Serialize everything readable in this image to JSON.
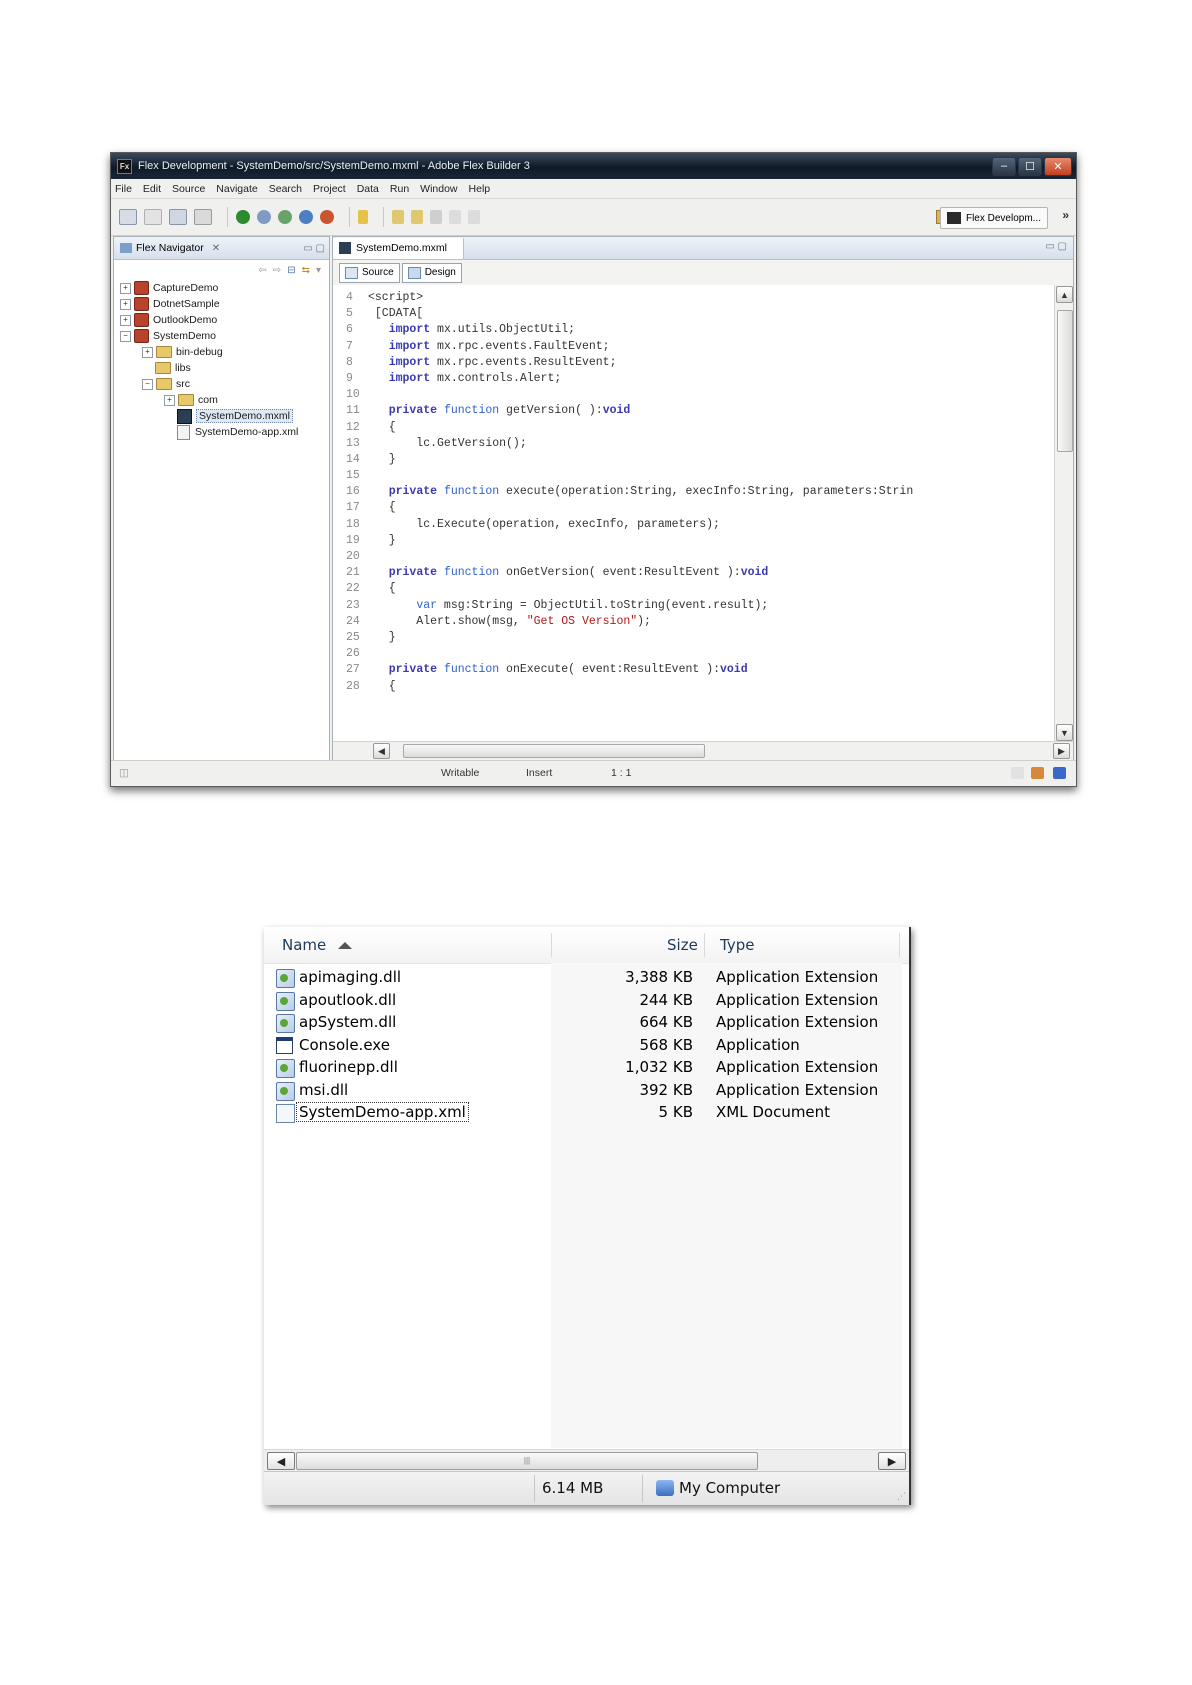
{
  "flex_builder": {
    "title": "Flex Development - SystemDemo/src/SystemDemo.mxml - Adobe Flex Builder 3",
    "app_icon": "Fx",
    "menu": [
      "File",
      "Edit",
      "Source",
      "Navigate",
      "Search",
      "Project",
      "Data",
      "Run",
      "Window",
      "Help"
    ],
    "perspective": "Flex Developm...",
    "perspective_overflow": "»",
    "navigator": {
      "tab": "Flex Navigator",
      "tab_close": "✕",
      "items": [
        {
          "label": "CaptureDemo",
          "exp": "+"
        },
        {
          "label": "DotnetSample",
          "exp": "+"
        },
        {
          "label": "OutlookDemo",
          "exp": "+"
        },
        {
          "label": "SystemDemo",
          "exp": "−"
        },
        {
          "label": "bin-debug",
          "exp": "+"
        },
        {
          "label": "libs"
        },
        {
          "label": "src",
          "exp": "−"
        },
        {
          "label": "com",
          "exp": "+"
        },
        {
          "label": "SystemDemo.mxml"
        },
        {
          "label": "SystemDemo-app.xml"
        }
      ]
    },
    "editor": {
      "tab": "SystemDemo.mxml",
      "source_btn": "Source",
      "design_btn": "Design",
      "lines": [
        {
          "n": "4",
          "t": "<script>"
        },
        {
          "n": "5",
          "t": " [CDATA["
        },
        {
          "n": "6",
          "t": "   import mx.utils.ObjectUtil;"
        },
        {
          "n": "7",
          "t": "   import mx.rpc.events.FaultEvent;"
        },
        {
          "n": "8",
          "t": "   import mx.rpc.events.ResultEvent;"
        },
        {
          "n": "9",
          "t": "   import mx.controls.Alert;"
        },
        {
          "n": "10",
          "t": ""
        },
        {
          "n": "11",
          "t": "   private function getVersion( ):void"
        },
        {
          "n": "12",
          "t": "   {"
        },
        {
          "n": "13",
          "t": "       lc.GetVersion();"
        },
        {
          "n": "14",
          "t": "   }"
        },
        {
          "n": "15",
          "t": ""
        },
        {
          "n": "16",
          "t": "   private function execute(operation:String, execInfo:String, parameters:Strin"
        },
        {
          "n": "17",
          "t": "   {"
        },
        {
          "n": "18",
          "t": "       lc.Execute(operation, execInfo, parameters);"
        },
        {
          "n": "19",
          "t": "   }"
        },
        {
          "n": "20",
          "t": ""
        },
        {
          "n": "21",
          "t": "   private function onGetVersion( event:ResultEvent ):void"
        },
        {
          "n": "22",
          "t": "   {"
        },
        {
          "n": "23",
          "t": "       var msg:String = ObjectUtil.toString(event.result);"
        },
        {
          "n": "24",
          "t": "       Alert.show(msg, \"Get OS Version\");"
        },
        {
          "n": "25",
          "t": "   }"
        },
        {
          "n": "26",
          "t": ""
        },
        {
          "n": "27",
          "t": "   private function onExecute( event:ResultEvent ):void"
        },
        {
          "n": "28",
          "t": "   {"
        }
      ]
    },
    "status": {
      "writable": "Writable",
      "insert": "Insert",
      "position": "1 : 1"
    }
  },
  "explorer": {
    "columns": {
      "name": "Name",
      "size": "Size",
      "type": "Type"
    },
    "files": [
      {
        "name": "apimaging.dll",
        "size": "3,388 KB",
        "type": "Application Extension",
        "icon": "dll-icon"
      },
      {
        "name": "apoutlook.dll",
        "size": "244 KB",
        "type": "Application Extension",
        "icon": "dll-icon"
      },
      {
        "name": "apSystem.dll",
        "size": "664 KB",
        "type": "Application Extension",
        "icon": "dll-icon"
      },
      {
        "name": "Console.exe",
        "size": "568 KB",
        "type": "Application",
        "icon": "exe-icon"
      },
      {
        "name": "fluorinepp.dll",
        "size": "1,032 KB",
        "type": "Application Extension",
        "icon": "dll-icon"
      },
      {
        "name": "msi.dll",
        "size": "392 KB",
        "type": "Application Extension",
        "icon": "dll-icon"
      },
      {
        "name": "SystemDemo-app.xml",
        "size": "5 KB",
        "type": "XML Document",
        "icon": "xml-document-icon"
      }
    ],
    "status": {
      "total_size": "6.14 MB",
      "location": "My Computer"
    }
  }
}
